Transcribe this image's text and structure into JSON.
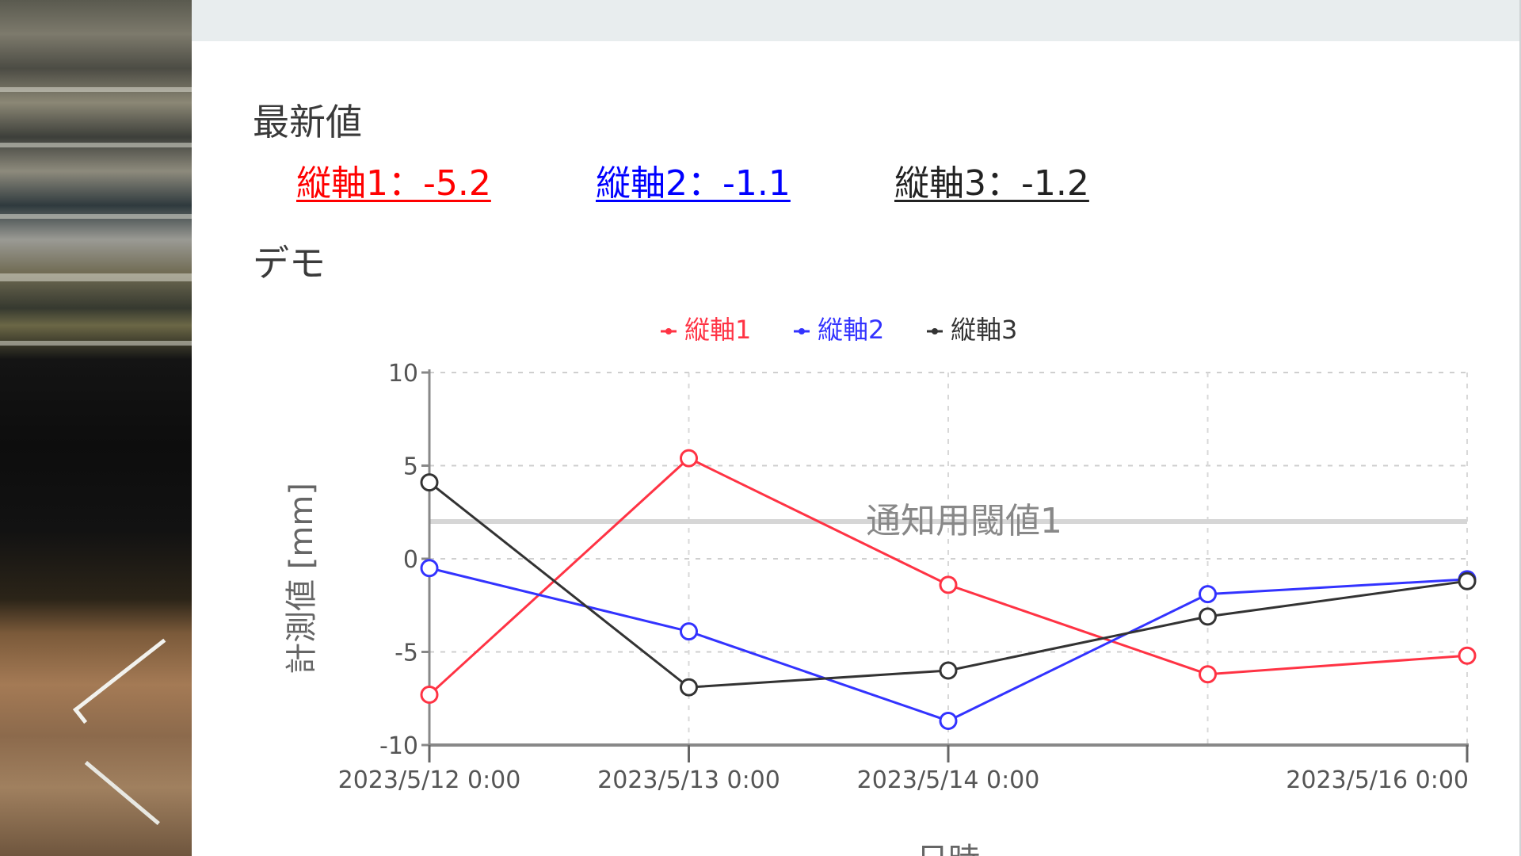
{
  "latest": {
    "heading": "最新値",
    "items": [
      {
        "label": "縦軸1：-5.2",
        "color": "#ff0000"
      },
      {
        "label": "縦軸2：-1.1",
        "color": "#0000ff"
      },
      {
        "label": "縦軸3：-1.2",
        "color": "#222222"
      }
    ]
  },
  "section_title": "デモ",
  "chart_data": {
    "type": "line",
    "x": [
      "2023/5/12 0:00",
      "2023/5/13 0:00",
      "2023/5/14 0:00",
      "2023/5/15 0:00",
      "2023/5/16 0:00"
    ],
    "xtick_labels": [
      "2023/5/12 0:00",
      "2023/5/13 0:00",
      "2023/5/14 0:00",
      "",
      "2023/5/16 0:00"
    ],
    "series": [
      {
        "name": "縦軸1",
        "color": "#ff3344",
        "values": [
          -7.3,
          5.4,
          -1.4,
          -6.2,
          -5.2
        ]
      },
      {
        "name": "縦軸2",
        "color": "#3333ff",
        "values": [
          -0.5,
          -3.9,
          -8.7,
          -1.9,
          -1.1
        ]
      },
      {
        "name": "縦軸3",
        "color": "#333333",
        "values": [
          4.1,
          -6.9,
          -6.0,
          -3.1,
          -1.2
        ]
      }
    ],
    "threshold": {
      "label": "通知用閾値1",
      "value": 2.0,
      "color": "#d6d6d6"
    },
    "ylabel": "計測値 [mm]",
    "xlabel": "日時",
    "ylim": [
      -10,
      10
    ],
    "yticks": [
      10,
      5,
      0,
      -5,
      -10
    ],
    "grid": true,
    "legend": "top-center"
  }
}
